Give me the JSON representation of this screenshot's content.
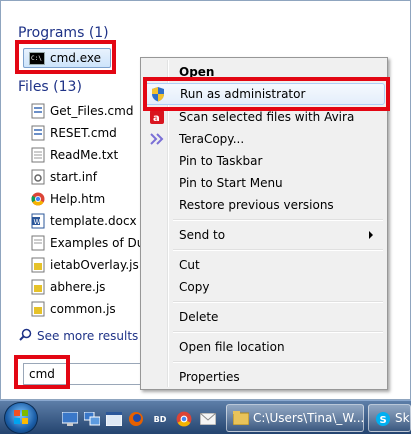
{
  "start_menu": {
    "programs_header": "Programs (1)",
    "files_header": "Files (13)",
    "program_result": {
      "label": "cmd.exe",
      "icon": "cmd-icon"
    },
    "file_results": [
      {
        "label": "Get_Files.cmd",
        "icon": "script-file-icon"
      },
      {
        "label": "RESET.cmd",
        "icon": "script-file-icon"
      },
      {
        "label": "ReadMe.txt",
        "icon": "text-file-icon"
      },
      {
        "label": "start.inf",
        "icon": "settings-file-icon"
      },
      {
        "label": "Help.htm",
        "icon": "chrome-icon"
      },
      {
        "label": "template.docx",
        "icon": "word-document-icon"
      },
      {
        "label": "Examples of Dupli",
        "icon": "text-file-icon"
      },
      {
        "label": "ietabOverlay.js",
        "icon": "javascript-file-icon"
      },
      {
        "label": "abhere.js",
        "icon": "javascript-file-icon"
      },
      {
        "label": "common.js",
        "icon": "javascript-file-icon"
      }
    ],
    "see_more": "See more results",
    "search_value": "cmd"
  },
  "context_menu": {
    "open": "Open",
    "run_as_admin": "Run as administrator",
    "scan_avira": "Scan selected files with Avira",
    "teracopy": "TeraCopy...",
    "pin_taskbar": "Pin to Taskbar",
    "pin_start": "Pin to Start Menu",
    "restore_versions": "Restore previous versions",
    "send_to": "Send to",
    "cut": "Cut",
    "copy": "Copy",
    "delete": "Delete",
    "open_location": "Open file location",
    "properties": "Properties"
  },
  "taskbar": {
    "quick_launch_bd": "BD",
    "explorer_button": "C:\\Users\\Tina\\_W...",
    "skype_button": "Sk"
  },
  "colors": {
    "highlight": "#e30613",
    "section_header": "#1e3287",
    "taskbar": "#24446f"
  }
}
